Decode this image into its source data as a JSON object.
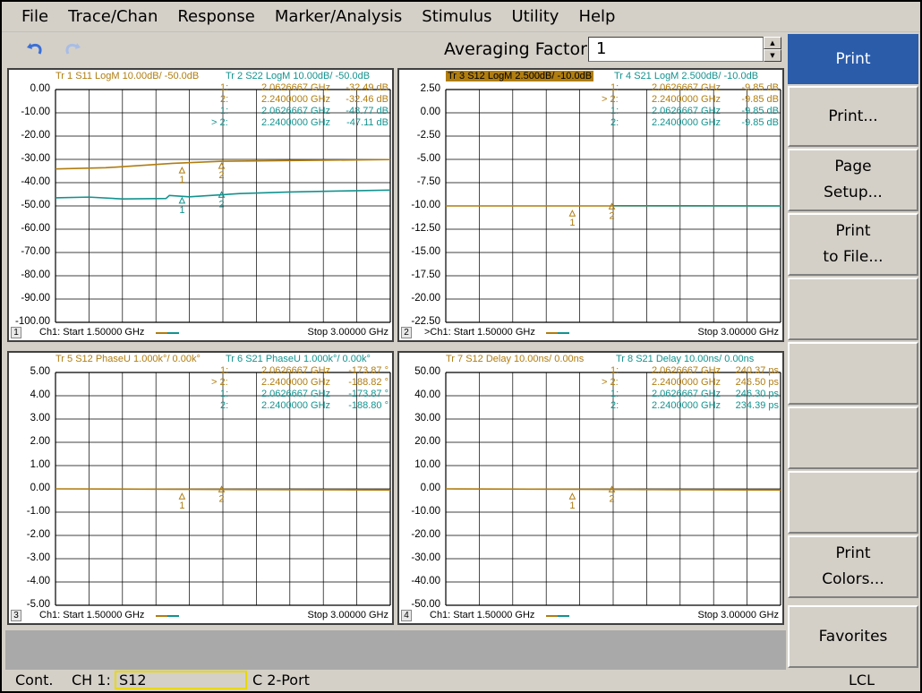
{
  "menubar": {
    "items": [
      "File",
      "Trace/Chan",
      "Response",
      "Marker/Analysis",
      "Stimulus",
      "Utility",
      "Help"
    ]
  },
  "toolbar": {
    "undo_icon": "undo-icon",
    "redo_icon": "redo-icon",
    "avg_label": "Averaging Factor",
    "avg_value": "1"
  },
  "colors": {
    "trace_a": "#b07d10",
    "trace_b": "#13938f",
    "active_key": "#2a5caa",
    "ch_highlight": "#e8d800"
  },
  "panels": [
    {
      "num": "1",
      "trA": "Tr 1  S11 LogM 10.00dB/  -50.0dB",
      "trB": "Tr 2  S22 LogM 10.00dB/  -50.0dB",
      "trA_active": false,
      "y_labels": [
        "0.00",
        "-10.00",
        "-20.00",
        "-30.00",
        "-40.00",
        "-50.00",
        "-60.00",
        "-70.00",
        "-80.00",
        "-90.00",
        "-100.00"
      ],
      "markers": [
        {
          "id": "1:",
          "freq": "2.0626667 GHz",
          "val": "-32.49 dB",
          "color": "a"
        },
        {
          "id": "2:",
          "freq": "2.2400000 GHz",
          "val": "-32.46 dB",
          "color": "a"
        },
        {
          "id": "1:",
          "freq": "2.0626667 GHz",
          "val": "-48.77 dB",
          "color": "b"
        },
        {
          "id": "> 2:",
          "freq": "2.2400000 GHz",
          "val": "-47.11 dB",
          "color": "b"
        }
      ],
      "foot_ch": "Ch1:  Start  1.50000 GHz",
      "foot_stop": "Stop  3.00000 GHz"
    },
    {
      "num": "2",
      "trA": "Tr 3  S12 LogM 2.500dB/  -10.0dB",
      "trB": "Tr 4  S21 LogM 2.500dB/  -10.0dB",
      "trA_active": true,
      "y_labels": [
        "2.50",
        "0.00",
        "-2.50",
        "-5.00",
        "-7.50",
        "-10.00",
        "-12.50",
        "-15.00",
        "-17.50",
        "-20.00",
        "-22.50"
      ],
      "markers": [
        {
          "id": "1:",
          "freq": "2.0626667 GHz",
          "val": "-9.85 dB",
          "color": "a"
        },
        {
          "id": "> 2:",
          "freq": "2.2400000 GHz",
          "val": "-9.85 dB",
          "color": "a"
        },
        {
          "id": "1:",
          "freq": "2.0626667 GHz",
          "val": "-9.85 dB",
          "color": "b"
        },
        {
          "id": "2:",
          "freq": "2.2400000 GHz",
          "val": "-9.85 dB",
          "color": "b"
        }
      ],
      "foot_ch": ">Ch1:  Start  1.50000 GHz",
      "foot_stop": "Stop  3.00000 GHz"
    },
    {
      "num": "3",
      "trA": "Tr 5  S12 PhaseU 1.000k°/  0.00k°",
      "trB": "Tr 6  S21 PhaseU 1.000k°/  0.00k°",
      "trA_active": false,
      "y_labels": [
        "5.00",
        "4.00",
        "3.00",
        "2.00",
        "1.00",
        "0.00",
        "-1.00",
        "-2.00",
        "-3.00",
        "-4.00",
        "-5.00"
      ],
      "markers": [
        {
          "id": "1:",
          "freq": "2.0626667 GHz",
          "val": "-173.87 °",
          "color": "a"
        },
        {
          "id": "> 2:",
          "freq": "2.2400000 GHz",
          "val": "-188.82 °",
          "color": "a"
        },
        {
          "id": "1:",
          "freq": "2.0626667 GHz",
          "val": "-173.87 °",
          "color": "b"
        },
        {
          "id": "2:",
          "freq": "2.2400000 GHz",
          "val": "-188.80 °",
          "color": "b"
        }
      ],
      "foot_ch": "Ch1:  Start  1.50000 GHz",
      "foot_stop": "Stop  3.00000 GHz"
    },
    {
      "num": "4",
      "trA": "Tr 7  S12 Delay 10.00ns/  0.00ns",
      "trB": "Tr 8  S21 Delay 10.00ns/  0.00ns",
      "trA_active": false,
      "y_labels": [
        "50.00",
        "40.00",
        "30.00",
        "20.00",
        "10.00",
        "0.00",
        "-10.00",
        "-20.00",
        "-30.00",
        "-40.00",
        "-50.00"
      ],
      "markers": [
        {
          "id": "1:",
          "freq": "2.0626667 GHz",
          "val": "240.37 ps",
          "color": "a"
        },
        {
          "id": "> 2:",
          "freq": "2.2400000 GHz",
          "val": "246.50 ps",
          "color": "a"
        },
        {
          "id": "1:",
          "freq": "2.0626667 GHz",
          "val": "246.30 ps",
          "color": "b"
        },
        {
          "id": "2:",
          "freq": "2.2400000 GHz",
          "val": "234.39 ps",
          "color": "b"
        }
      ],
      "foot_ch": "Ch1:  Start  1.50000 GHz",
      "foot_stop": "Stop  3.00000 GHz"
    }
  ],
  "softkeys": {
    "print": "Print",
    "print_dialog": "Print...",
    "page_setup_1": "Page",
    "page_setup_2": "Setup...",
    "print_file_1": "Print",
    "print_file_2": "to File...",
    "print_colors_1": "Print",
    "print_colors_2": "Colors...",
    "favorites": "Favorites"
  },
  "status": {
    "mode": "Cont.",
    "ch": "CH 1:",
    "param": "S12",
    "cal": "C  2-Port",
    "remote": "LCL"
  }
}
